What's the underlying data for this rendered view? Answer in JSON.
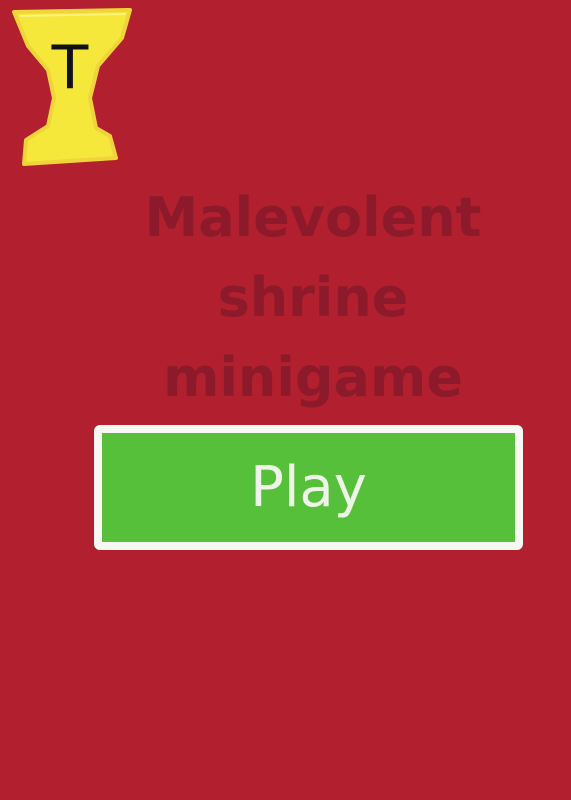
{
  "title": {
    "line1": "Malevolent",
    "line2": "shrine",
    "line3": "minigame"
  },
  "play_button": {
    "label": "Play"
  },
  "trophy": {
    "icon": "trophy-icon",
    "letter": "T",
    "color": "#f5e83a"
  },
  "colors": {
    "background": "#b21f2e",
    "title": "#8c1a2a",
    "button": "#56c03a",
    "button_border": "#f7f7f3"
  }
}
